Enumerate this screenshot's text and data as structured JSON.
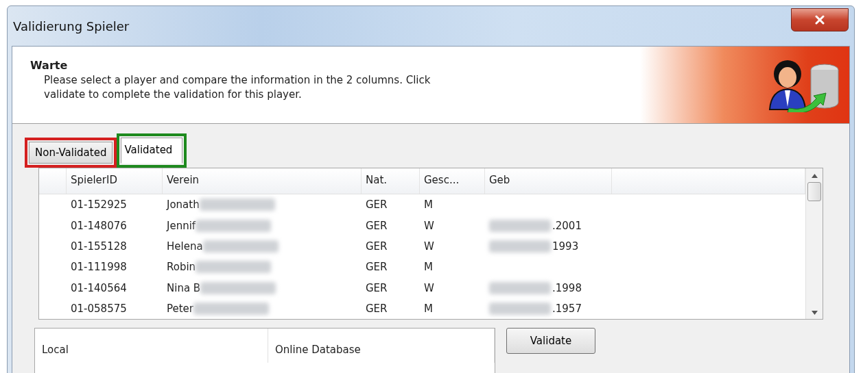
{
  "window": {
    "title": "Validierung Spieler"
  },
  "header": {
    "title": "Warte",
    "description": "Please select a player and compare the information in the 2 columns. Click validate to complete the validation for this player."
  },
  "tabs": [
    {
      "label": "Non-Validated",
      "selected": false,
      "color": "#d42020"
    },
    {
      "label": "Validated",
      "selected": true,
      "color": "#1e8a1e"
    }
  ],
  "table": {
    "columns": [
      "SpielerID",
      "Verein",
      "Nat.",
      "Gesc...",
      "Geb"
    ],
    "rows": [
      {
        "id": "01-152925",
        "name": "Jonath",
        "name_redacted": true,
        "nat": "GER",
        "gender": "M",
        "dob": "",
        "dob_redacted": false
      },
      {
        "id": "01-148076",
        "name": "Jennif",
        "name_redacted": true,
        "nat": "GER",
        "gender": "W",
        "dob": ".2001",
        "dob_redacted": true
      },
      {
        "id": "01-155128",
        "name": "Helena",
        "name_redacted": true,
        "nat": "GER",
        "gender": "W",
        "dob": "1993",
        "dob_redacted": true
      },
      {
        "id": "01-111998",
        "name": "Robin",
        "name_redacted": true,
        "nat": "GER",
        "gender": "M",
        "dob": "",
        "dob_redacted": false
      },
      {
        "id": "01-140564",
        "name": "Nina B",
        "name_redacted": true,
        "nat": "GER",
        "gender": "W",
        "dob": ".1998",
        "dob_redacted": true
      },
      {
        "id": "01-058575",
        "name": "Peter",
        "name_redacted": true,
        "nat": "GER",
        "gender": "M",
        "dob": ".1957",
        "dob_redacted": true
      }
    ]
  },
  "compare": {
    "columns": [
      "Local",
      "Online Database"
    ]
  },
  "buttons": [
    "Validate"
  ]
}
